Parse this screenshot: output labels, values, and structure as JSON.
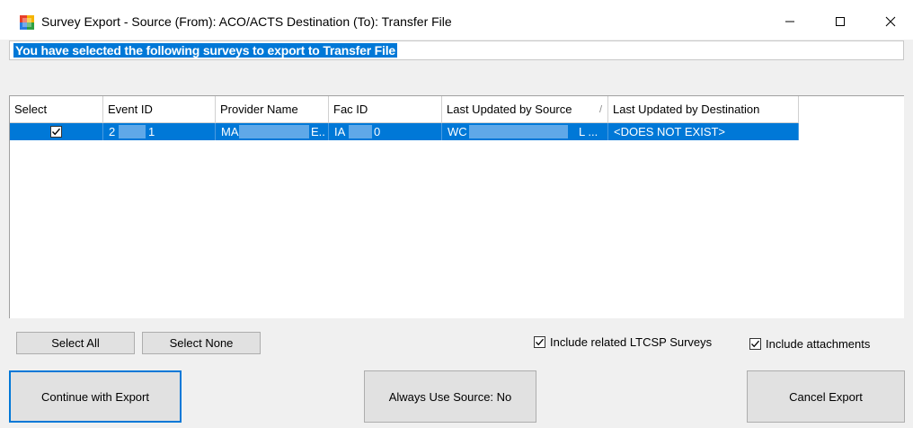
{
  "window": {
    "title": "Survey Export - Source (From): ACO/ACTS  Destination (To): Transfer File",
    "controls": {
      "minimize": "—",
      "maximize": "☐",
      "close": "✕"
    }
  },
  "heading": "You have selected the following surveys to export to Transfer File",
  "grid": {
    "columns": [
      "Select",
      "Event ID",
      "Provider Name",
      "Fac ID",
      "Last Updated by Source",
      "Last Updated by Destination"
    ],
    "sort_indicator": "/",
    "rows": [
      {
        "selected": true,
        "event_id": [
          "2",
          "1"
        ],
        "provider_name": [
          "MA",
          "E.."
        ],
        "fac_id": [
          "IA",
          "0"
        ],
        "last_updated_source": [
          "WC",
          "L ..."
        ],
        "last_updated_destination": "<DOES NOT EXIST>"
      }
    ]
  },
  "buttons": {
    "select_all": "Select All",
    "select_none": "Select None",
    "continue": "Continue with Export",
    "always_use_source": "Always Use Source: No",
    "cancel": "Cancel Export"
  },
  "options": {
    "include_ltcsp_label": "Include related LTCSP Surveys",
    "include_ltcsp_checked": true,
    "include_attachments_label": "Include attachments",
    "include_attachments_checked": true
  },
  "colors": {
    "selection": "#0078d7",
    "window_bg": "#f0f0f0"
  }
}
